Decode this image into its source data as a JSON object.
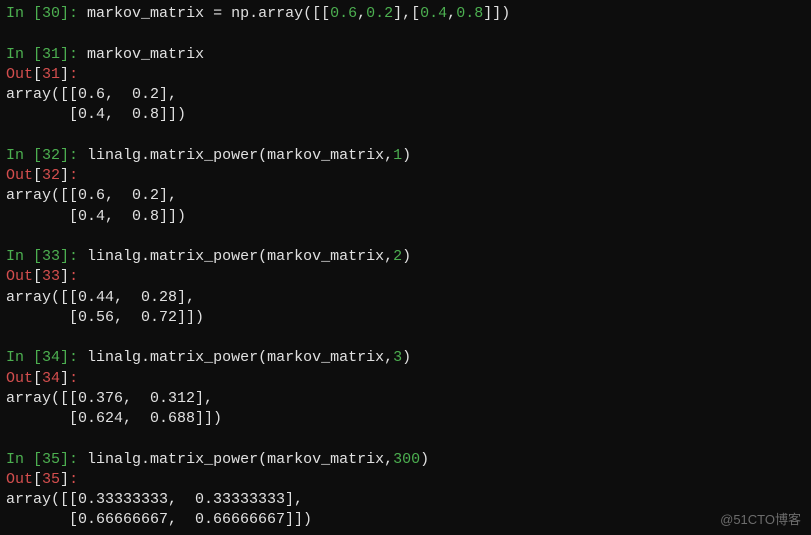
{
  "watermark": "@51CTO博客",
  "cells": [
    {
      "in_num": "30",
      "code_plain": "markov_matrix = np.array([[",
      "code_lits": [
        "0.6",
        "0.2",
        "0.4",
        "0.8"
      ],
      "code_tail1": ",",
      "code_tail2": "],[",
      "code_tail3": ",",
      "code_tail4": "]])",
      "has_out": false,
      "out_lines": []
    },
    {
      "in_num": "31",
      "code_plain": "markov_matrix",
      "has_out": true,
      "out_lines": [
        "array([[0.6,  0.2],",
        "       [0.4,  0.8]])"
      ]
    },
    {
      "in_num": "32",
      "code_plain": "linalg.matrix_power(markov_matrix,",
      "arg_lit": "1",
      "code_tail": ")",
      "has_out": true,
      "out_lines": [
        "array([[0.6,  0.2],",
        "       [0.4,  0.8]])"
      ]
    },
    {
      "in_num": "33",
      "code_plain": "linalg.matrix_power(markov_matrix,",
      "arg_lit": "2",
      "code_tail": ")",
      "has_out": true,
      "out_lines": [
        "array([[0.44,  0.28],",
        "       [0.56,  0.72]])"
      ]
    },
    {
      "in_num": "34",
      "code_plain": "linalg.matrix_power(markov_matrix,",
      "arg_lit": "3",
      "code_tail": ")",
      "has_out": true,
      "out_lines": [
        "array([[0.376,  0.312],",
        "       [0.624,  0.688]])"
      ]
    },
    {
      "in_num": "35",
      "code_plain": "linalg.matrix_power(markov_matrix,",
      "arg_lit": "300",
      "code_tail": ")",
      "has_out": true,
      "out_lines": [
        "array([[0.33333333,  0.33333333],",
        "       [0.66666667,  0.66666667]])"
      ]
    }
  ],
  "chart_data": {
    "type": "table",
    "title": "IPython session: powers of a 2×2 Markov matrix",
    "markov_matrix": [
      [
        0.6,
        0.2
      ],
      [
        0.4,
        0.8
      ]
    ],
    "powers": [
      {
        "k": 1,
        "result": [
          [
            0.6,
            0.2
          ],
          [
            0.4,
            0.8
          ]
        ]
      },
      {
        "k": 2,
        "result": [
          [
            0.44,
            0.28
          ],
          [
            0.56,
            0.72
          ]
        ]
      },
      {
        "k": 3,
        "result": [
          [
            0.376,
            0.312
          ],
          [
            0.624,
            0.688
          ]
        ]
      },
      {
        "k": 300,
        "result": [
          [
            0.33333333,
            0.33333333
          ],
          [
            0.66666667,
            0.66666667
          ]
        ]
      }
    ]
  }
}
